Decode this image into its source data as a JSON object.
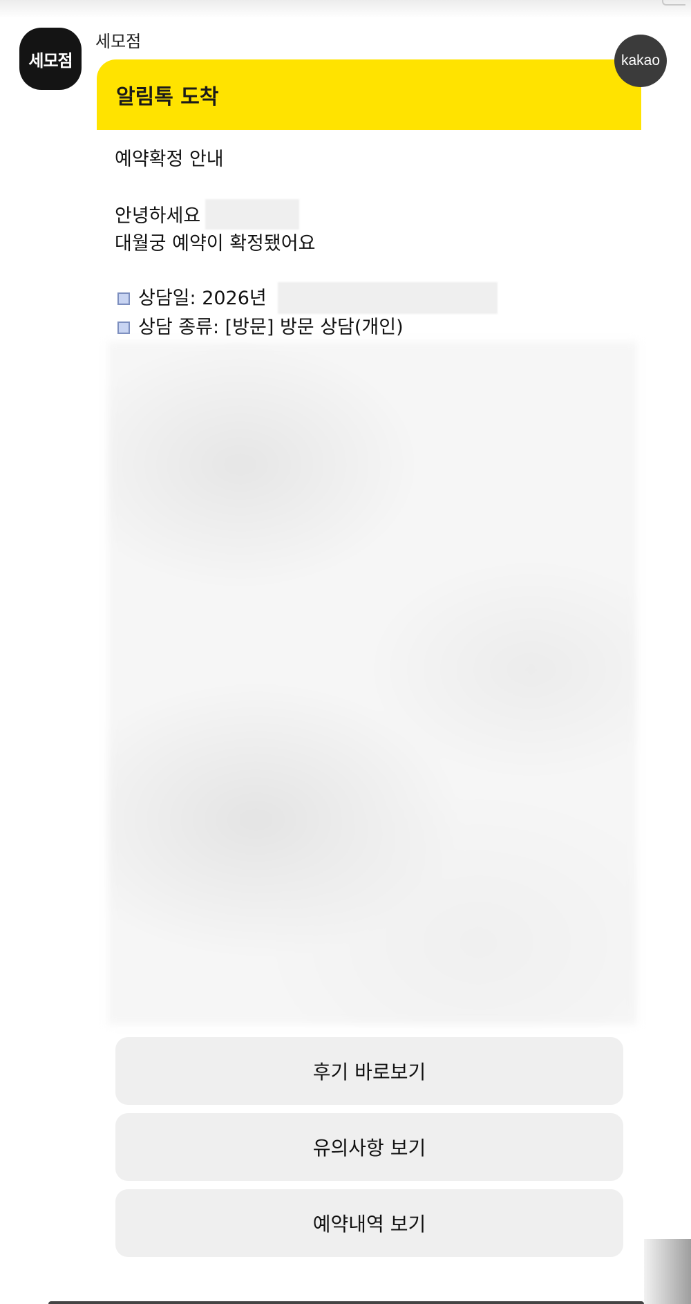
{
  "sender": {
    "avatar_text": "세모점",
    "name": "세모점"
  },
  "badge": {
    "label": "kakao"
  },
  "message": {
    "header_title": "알림톡 도착",
    "title": "예약확정 안내",
    "greeting": "안녕하세요",
    "confirmation": "대월궁 예약이 확정됐어요",
    "items": [
      {
        "text": "상담일: 2026년"
      },
      {
        "text": "상담 종류: [방문] 방문 상담(개인)"
      }
    ]
  },
  "buttons": {
    "review": "후기 바로보기",
    "notice": "유의사항 보기",
    "history": "예약내역 보기"
  },
  "colors": {
    "header_yellow": "#ffe300",
    "avatar_black": "#141414",
    "badge_gray": "#3b3b3b",
    "button_gray": "#efefef"
  }
}
